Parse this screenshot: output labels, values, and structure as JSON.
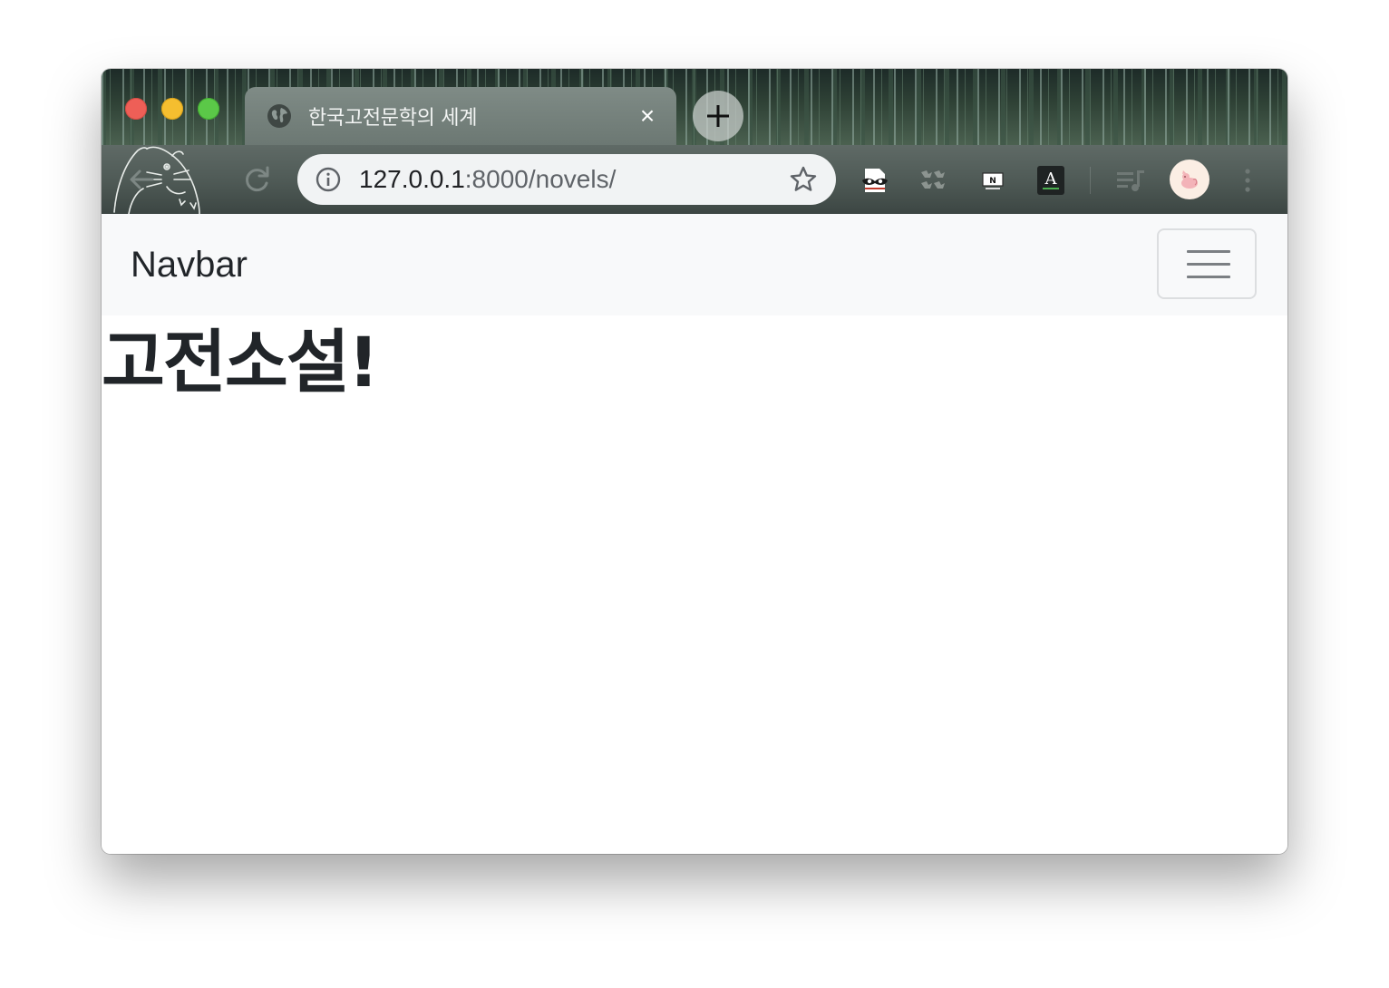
{
  "browser": {
    "tab": {
      "title": "한국고전문학의 세계",
      "favicon": "globe-icon",
      "close": "×"
    },
    "new_tab_icon": "plus-icon",
    "address_bar": {
      "host": "127.0.0.1",
      "path": ":8000/novels/",
      "info_icon": "info-icon",
      "bookmark_icon": "star-icon"
    },
    "extensions": [
      "incognito-mask-icon",
      "puzzle-icon",
      "notion-icon",
      "dictionary-icon",
      "playlist-icon"
    ],
    "profile_icon": "avatar-icon",
    "menu_icon": "more-vert-icon"
  },
  "navbar": {
    "brand": "Navbar",
    "toggler_icon": "hamburger-icon"
  },
  "main": {
    "heading": "고전소설!"
  },
  "colors": {
    "traffic_red": "#ee5f57",
    "traffic_yellow": "#f5be2f",
    "traffic_green": "#5bc848",
    "navbar_bg": "#f8f9fa",
    "text": "#212529"
  }
}
